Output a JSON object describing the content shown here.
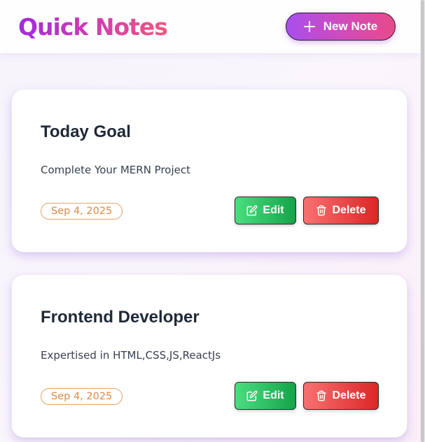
{
  "header": {
    "title": "Quick Notes",
    "new_note_label": "New Note"
  },
  "notes": [
    {
      "title": "Today Goal",
      "content": "Complete Your MERN Project",
      "date": "Sep 4, 2025",
      "edit_label": "Edit",
      "delete_label": "Delete"
    },
    {
      "title": "Frontend Developer",
      "content": "Expertised in HTML,CSS,JS,ReactJs",
      "date": "Sep 4, 2025",
      "edit_label": "Edit",
      "delete_label": "Delete"
    }
  ],
  "colors": {
    "title_gradient": [
      "#a12be0",
      "#f05a7e"
    ],
    "edit": "#22c55e",
    "delete": "#ef4444",
    "date_badge": "#d98a4b"
  },
  "icons": {
    "new_note": "plus-icon",
    "edit": "edit-icon",
    "delete": "trash-icon"
  }
}
